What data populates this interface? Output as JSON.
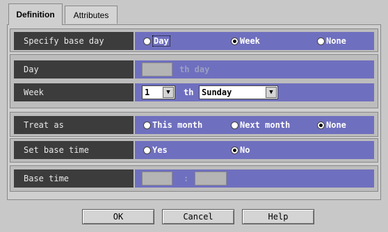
{
  "tabs": [
    {
      "label": "Definition"
    },
    {
      "label": "Attributes"
    }
  ],
  "specify_base_day": {
    "label": "Specify base day",
    "options": [
      {
        "label": "Day",
        "selected": false
      },
      {
        "label": "Week",
        "selected": true
      },
      {
        "label": "None",
        "selected": false
      }
    ]
  },
  "day": {
    "label": "Day",
    "value": "",
    "suffix": "th day"
  },
  "week": {
    "label": "Week",
    "number": "1",
    "suffix": "th",
    "weekday": "Sunday"
  },
  "treat_as": {
    "label": "Treat as",
    "options": [
      {
        "label": "This month",
        "selected": false
      },
      {
        "label": "Next month",
        "selected": false
      },
      {
        "label": "None",
        "selected": true
      }
    ]
  },
  "set_base_time": {
    "label": "Set base time",
    "options": [
      {
        "label": "Yes",
        "selected": false
      },
      {
        "label": "No",
        "selected": true
      }
    ]
  },
  "base_time": {
    "label": "Base time",
    "hour": "",
    "separator": ":",
    "minute": ""
  },
  "buttons": {
    "ok": "OK",
    "cancel": "Cancel",
    "help": "Help"
  },
  "colors": {
    "label_bg": "#3c3c3c",
    "field_bg": "#6f6fbf",
    "window_bg": "#c8c8c8"
  }
}
